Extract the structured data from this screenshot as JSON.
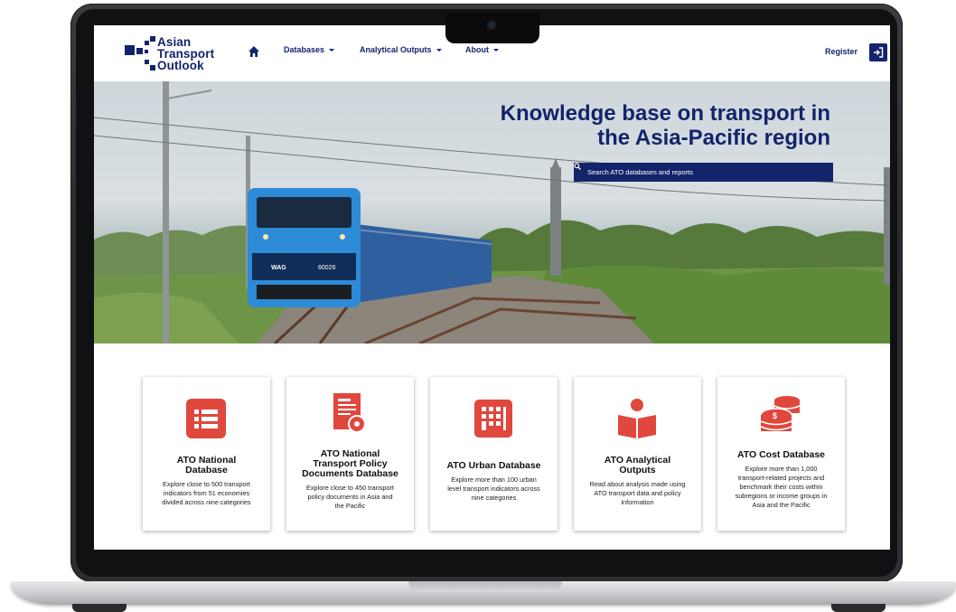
{
  "colors": {
    "brand_navy": "#13246b",
    "accent_red": "#e0473d"
  },
  "logo": {
    "lines": [
      "Asian",
      "Transport",
      "Outlook"
    ]
  },
  "nav": {
    "home_icon": "home-icon",
    "items": [
      {
        "label": "Databases"
      },
      {
        "label": "Analytical Outputs"
      },
      {
        "label": "About"
      }
    ],
    "register_label": "Register",
    "login_icon": "sign-in-icon"
  },
  "hero": {
    "title_line1": "Knowledge base on transport in",
    "title_line2": "the Asia-Pacific region",
    "search_placeholder": "Search ATO databases and reports",
    "locomotive_number": "60026",
    "locomotive_model": "WAG"
  },
  "cards": [
    {
      "icon": "list-icon",
      "title_lines": [
        "ATO National",
        "Database"
      ],
      "description_lines": [
        "Explore close to 500 transport",
        "indicators from 51 economies",
        "divided across nine categories"
      ]
    },
    {
      "icon": "policy-document-gear-icon",
      "title_lines": [
        "ATO National",
        "Transport Policy",
        "Documents Database"
      ],
      "description_lines": [
        "Explore close to 450 transport",
        "policy documents in Asia and",
        "the Pacific"
      ]
    },
    {
      "icon": "city-building-icon",
      "title_lines": [
        "ATO Urban Database"
      ],
      "description_lines": [
        "Explore more than 100 urban",
        "level transport indicators across",
        "nine categories"
      ]
    },
    {
      "icon": "reader-book-icon",
      "title_lines": [
        "ATO Analytical",
        "Outputs"
      ],
      "description_lines": [
        "Read about analysis made using",
        "ATO transport data and policy",
        "information"
      ]
    },
    {
      "icon": "coin-stack-icon",
      "title_lines": [
        "ATO Cost Database"
      ],
      "description_lines": [
        "Explore more than 1,000",
        "transport-related projects and",
        "benchmark their costs within",
        "subregions or income groups in",
        "Asia and the Pacific"
      ]
    }
  ]
}
